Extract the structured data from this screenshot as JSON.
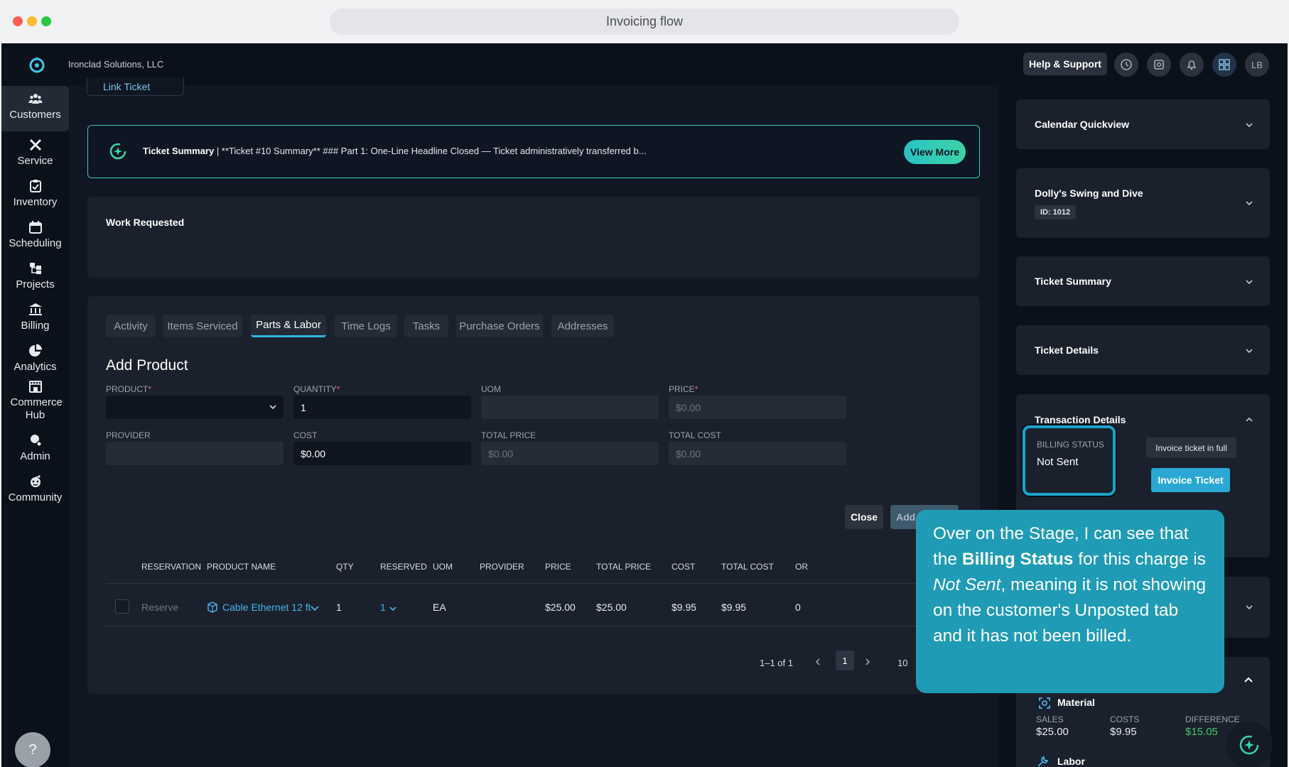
{
  "window": {
    "url_title": "Invoicing flow"
  },
  "header": {
    "company": "Ironclad Solutions, LLC",
    "help_label": "Help & Support",
    "avatar_initials": "LB"
  },
  "sidebar": {
    "items": [
      {
        "label": "Customers",
        "icon": "users-icon",
        "active": true
      },
      {
        "label": "Service",
        "icon": "tools-icon"
      },
      {
        "label": "Inventory",
        "icon": "clipboard-icon"
      },
      {
        "label": "Scheduling",
        "icon": "calendar-icon"
      },
      {
        "label": "Projects",
        "icon": "projects-icon"
      },
      {
        "label": "Billing",
        "icon": "bank-icon"
      },
      {
        "label": "Analytics",
        "icon": "pie-chart-icon"
      },
      {
        "label": "Commerce Hub",
        "icon": "store-icon"
      },
      {
        "label": "Admin",
        "icon": "admin-icon"
      },
      {
        "label": "Community",
        "icon": "community-icon"
      }
    ],
    "help_label": "?"
  },
  "main": {
    "link_ticket": "Link Ticket",
    "summary": {
      "label": "Ticket Summary",
      "text": " | **Ticket #10 Summary** ### Part 1: One-Line Headline Closed — Ticket administratively transferred b...",
      "view_more": "View More"
    },
    "work_requested": "Work Requested",
    "tabs": [
      "Activity",
      "Items Serviced",
      "Parts & Labor",
      "Time Logs",
      "Tasks",
      "Purchase Orders",
      "Addresses"
    ],
    "active_tab": "Parts & Labor",
    "add_product": {
      "title": "Add Product",
      "product_label": "PRODUCT",
      "quantity_label": "QUANTITY",
      "quantity_value": "1",
      "uom_label": "UOM",
      "price_label": "PRICE",
      "price_placeholder": "$0.00",
      "provider_label": "PROVIDER",
      "cost_label": "COST",
      "cost_value": "$0.00",
      "total_price_label": "TOTAL PRICE",
      "total_price_placeholder": "$0.00",
      "total_cost_label": "TOTAL COST",
      "total_cost_placeholder": "$0.00",
      "required_mark": "*",
      "close_label": "Close",
      "add_label": "Add"
    },
    "table": {
      "headers": [
        "RESERVATION",
        "PRODUCT NAME",
        "QTY",
        "RESERVED",
        "UOM",
        "PROVIDER",
        "PRICE",
        "TOTAL PRICE",
        "COST",
        "TOTAL COST",
        "OR"
      ],
      "row": {
        "reservation": "Reserve",
        "product_name": "Cable Ethernet 12 ft",
        "qty": "1",
        "reserved": "1",
        "uom": "EA",
        "provider": "",
        "price": "$25.00",
        "total_price": "$25.00",
        "cost": "$9.95",
        "total_cost": "$9.95",
        "or": "0"
      },
      "pagination": {
        "range": "1–1 of 1",
        "page": "1",
        "per_page": "10"
      }
    }
  },
  "right_panel": {
    "calendar": "Calendar Quickview",
    "customer": {
      "name": "Dolly's Swing and Dive",
      "id": "ID: 1012"
    },
    "ticket_summary": "Ticket Summary",
    "ticket_details": "Ticket Details",
    "transaction": {
      "title": "Transaction Details",
      "billing_status_label": "BILLING STATUS",
      "billing_status_value": "Not Sent",
      "tooltip": "Invoice ticket in full",
      "invoice_button": "Invoice Ticket"
    },
    "material": {
      "title": "Material",
      "sales_label": "SALES",
      "sales_value": "$25.00",
      "costs_label": "COSTS",
      "costs_value": "$9.95",
      "difference_label": "DIFFERENCE",
      "difference_value": "$15.05"
    },
    "labor": {
      "title": "Labor"
    }
  },
  "callout": {
    "p1": "Over on the Stage, I can see that the ",
    "bold": "Billing Status",
    "p2": " for this charge is ",
    "italic": "Not Sent",
    "p3": ", meaning it is not showing on the customer's Unposted tab and it has not been billed."
  },
  "colors": {
    "accent": "#2aa7d3",
    "callout_bg": "#1f9bb5",
    "success": "#45c96b",
    "app_bg": "#101722"
  }
}
